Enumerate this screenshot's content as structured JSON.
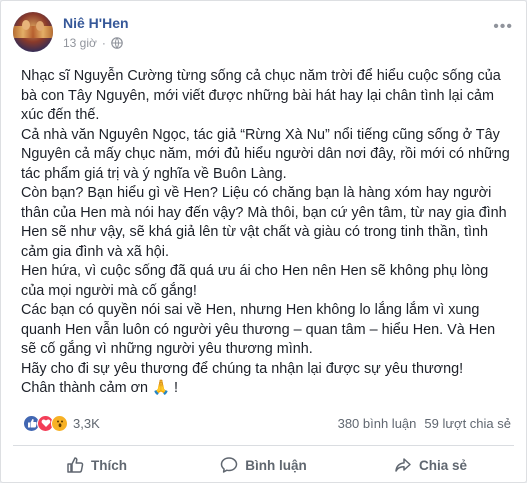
{
  "post": {
    "author": "Niê H'Hen",
    "time": "13 giờ",
    "paragraphs": [
      "Nhạc sĩ Nguyễn Cường từng sống cả chục năm trời để hiểu cuộc sống của bà con Tây Nguyên, mới viết được những bài hát hay lại chân tình lại cảm xúc đến thế.",
      "Cả nhà văn Nguyên Ngọc, tác giả “Rừng Xà Nu” nổi tiếng cũng sống ở Tây Nguyên cả mấy chục năm, mới đủ hiểu người dân nơi đây, rồi mới có những tác phẩm giá trị và ý nghĩa về Buôn Làng.",
      "Còn bạn? Bạn hiểu gì về Hen? Liệu có chăng bạn là hàng xóm hay người thân của Hen mà nói hay đến vậy? Mà thôi, bạn cứ yên tâm, từ nay gia đình Hen sẽ như vậy, sẽ khá giả lên từ vật chất và giàu có trong tinh thần, tình cảm gia đình và xã hội.",
      "Hen hứa, vì cuộc sống đã quá ưu ái cho Hen nên Hen sẽ không phụ lòng của mọi người mà cố gắng!",
      "Các bạn có quyền nói sai về Hen, nhưng Hen không lo lắng lắm vì xung quanh Hen vẫn luôn có người yêu thương – quan tâm – hiểu Hen. Và Hen sẽ cố gắng vì những người yêu thương mình.",
      "Hãy cho đi sự yêu thương để chúng ta nhận lại được sự yêu thương!"
    ],
    "closing_text": "Chân thành cảm ơn",
    "closing_emoji": "🙏",
    "closing_suffix": "!"
  },
  "stats": {
    "reaction_count": "3,3K",
    "comments": "380 bình luận",
    "shares": "59 lượt chia sẻ"
  },
  "actions": {
    "like": "Thích",
    "comment": "Bình luận",
    "share": "Chia sẻ"
  },
  "icons": {
    "privacy": "globe-icon",
    "more": "more-options-icon",
    "reactions": [
      "like-reaction-icon",
      "love-reaction-icon",
      "wow-reaction-icon"
    ]
  },
  "colors": {
    "author": "#365899",
    "like": "#4267b2",
    "love": "#f33e58",
    "wow": "#f7b125"
  }
}
